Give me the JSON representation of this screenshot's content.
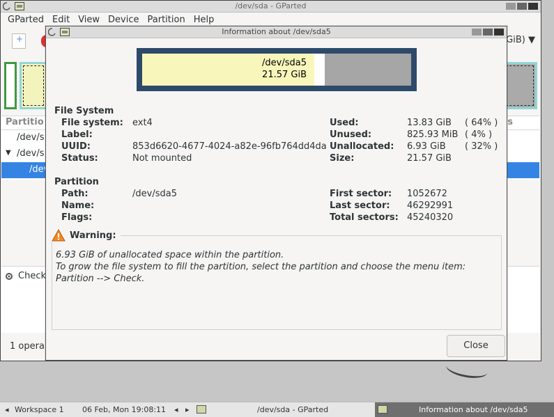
{
  "main_window": {
    "title": "/dev/sda - GParted",
    "menu": [
      "GParted",
      "Edit",
      "View",
      "Device",
      "Partition",
      "Help"
    ],
    "device_combo": "GiB)",
    "list_header_left": "Partitio",
    "list_header_right": "s",
    "rows": [
      "/dev/s",
      "/dev/s",
      "/dev"
    ],
    "ops_item": "Check",
    "status": "1 opera"
  },
  "dialog": {
    "title": "Information about /dev/sda5",
    "usage_bar": {
      "name": "/dev/sda5",
      "size": "21.57 GiB",
      "used_fraction": 0.64,
      "unused_fraction": 0.04,
      "unallocated_fraction": 0.32
    },
    "file_system": {
      "heading": "File System",
      "labels": {
        "fs": "File system:",
        "label": "Label:",
        "uuid": "UUID:",
        "status": "Status:"
      },
      "values": {
        "fs": "ext4",
        "label": "",
        "uuid": "853d6620-4677-4024-a82e-96fb764dd4da",
        "status": "Not mounted"
      },
      "right_labels": {
        "used": "Used:",
        "unused": "Unused:",
        "unallocated": "Unallocated:",
        "size": "Size:"
      },
      "right_values": {
        "used": "13.83 GiB",
        "unused": "825.93 MiB",
        "unallocated": "6.93 GiB",
        "size": "21.57 GiB"
      },
      "percents": {
        "used": "( 64% )",
        "unused": "( 4% )",
        "unallocated": "( 32% )"
      }
    },
    "partition": {
      "heading": "Partition",
      "labels": {
        "path": "Path:",
        "name": "Name:",
        "flags": "Flags:"
      },
      "values": {
        "path": "/dev/sda5",
        "name": "",
        "flags": ""
      },
      "right_labels": {
        "first": "First sector:",
        "last": "Last sector:",
        "total": "Total sectors:"
      },
      "right_values": {
        "first": "1052672",
        "last": "46292991",
        "total": "45240320"
      }
    },
    "warning": {
      "title": "Warning:",
      "line1": "6.93 GiB of unallocated space within the partition.",
      "line2": "To grow the file system to fill the partition, select the partition and choose the menu item:",
      "line3": "Partition --> Check."
    },
    "close_label": "Close"
  },
  "taskbar": {
    "workspace": "Workspace 1",
    "clock": "06 Feb, Mon 19:08:11",
    "task1": "/dev/sda - GParted",
    "task2": "Information about /dev/sda5"
  },
  "colors": {
    "used": "#f8f6bb",
    "unallocated": "#a6a6a6",
    "frame": "#2e4a6b",
    "selection": "#3584e4"
  }
}
